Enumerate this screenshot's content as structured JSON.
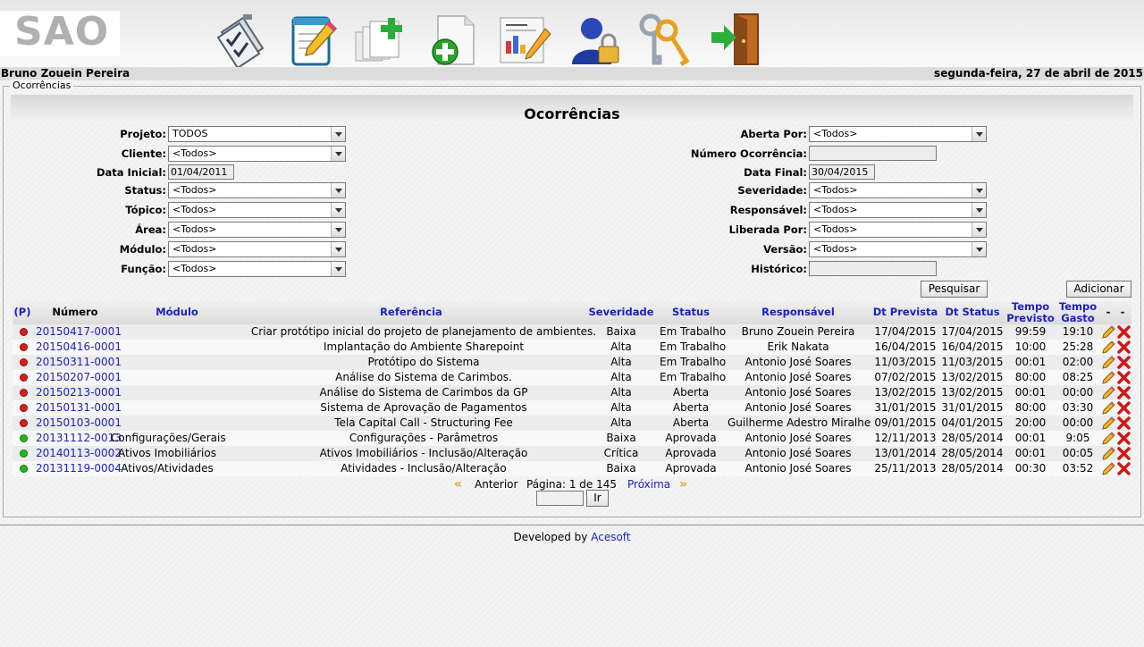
{
  "app": {
    "logo": "SAO"
  },
  "toolbar": {
    "icons": [
      "checklist-icon",
      "notepad-pencil-icon",
      "add-documents-icon",
      "new-document-icon",
      "report-icon",
      "user-lock-icon",
      "keys-icon",
      "exit-door-icon"
    ]
  },
  "userbar": {
    "user": "Bruno Zouein Pereira",
    "date": "segunda-feira, 27 de abril de 2015"
  },
  "section": {
    "legend": "Ocorrências",
    "title": "Ocorrências"
  },
  "filters": {
    "projeto_label": "Projeto:",
    "projeto_value": "TODOS",
    "cliente_label": "Cliente:",
    "cliente_value": "<Todos>",
    "data_inicial_label": "Data Inicial:",
    "data_inicial_value": "01/04/2011",
    "status_label": "Status:",
    "status_value": "<Todos>",
    "topico_label": "Tópico:",
    "topico_value": "<Todos>",
    "area_label": "Área:",
    "area_value": "<Todos>",
    "modulo_label": "Módulo:",
    "modulo_value": "<Todos>",
    "funcao_label": "Função:",
    "funcao_value": "<Todos>",
    "aberta_por_label": "Aberta Por:",
    "aberta_por_value": "<Todos>",
    "numero_label": "Número Ocorrência:",
    "numero_value": "",
    "data_final_label": "Data Final:",
    "data_final_value": "30/04/2015",
    "severidade_label": "Severidade:",
    "severidade_value": "<Todos>",
    "responsavel_label": "Responsável:",
    "responsavel_value": "<Todos>",
    "liberada_label": "Liberada Por:",
    "liberada_value": "<Todos>",
    "versao_label": "Versão:",
    "versao_value": "<Todos>",
    "historico_label": "Histórico:",
    "historico_value": ""
  },
  "buttons": {
    "pesquisar": "Pesquisar",
    "adicionar": "Adicionar",
    "ir": "Ir"
  },
  "columns": {
    "p": "(P)",
    "numero": "Número",
    "modulo": "Módulo",
    "referencia": "Referência",
    "severidade": "Severidade",
    "status": "Status",
    "responsavel": "Responsável",
    "dt_prevista": "Dt Prevista",
    "dt_status": "Dt Status",
    "tempo_previsto_1": "Tempo",
    "tempo_previsto_2": "Previsto",
    "tempo_gasto_1": "Tempo",
    "tempo_gasto_2": "Gasto",
    "dash1": "-",
    "dash2": "-"
  },
  "colors": {
    "red_dot": "#d81e1e",
    "green_dot": "#22b622",
    "link": "#1e20c0"
  },
  "rows": [
    {
      "dot": "red",
      "numero": "20150417-0001",
      "modulo": "",
      "referencia": "Criar protótipo inicial do projeto de planejamento de ambientes.",
      "severidade": "Baixa",
      "status": "Em Trabalho",
      "responsavel": "Bruno Zouein Pereira",
      "dt_prevista": "17/04/2015",
      "dt_status": "17/04/2015",
      "tempo_previsto": "99:59",
      "tempo_gasto": "19:10"
    },
    {
      "dot": "red",
      "numero": "20150416-0001",
      "modulo": "",
      "referencia": "Implantação do Ambiente Sharepoint",
      "severidade": "Alta",
      "status": "Em Trabalho",
      "responsavel": "Erik Nakata",
      "dt_prevista": "16/04/2015",
      "dt_status": "16/04/2015",
      "tempo_previsto": "10:00",
      "tempo_gasto": "25:28"
    },
    {
      "dot": "red",
      "numero": "20150311-0001",
      "modulo": "",
      "referencia": "Protótipo do Sistema",
      "severidade": "Alta",
      "status": "Em Trabalho",
      "responsavel": "Antonio José Soares",
      "dt_prevista": "11/03/2015",
      "dt_status": "11/03/2015",
      "tempo_previsto": "00:01",
      "tempo_gasto": "02:00"
    },
    {
      "dot": "red",
      "numero": "20150207-0001",
      "modulo": "",
      "referencia": "Análise do Sistema de Carimbos.",
      "severidade": "Alta",
      "status": "Em Trabalho",
      "responsavel": "Antonio José Soares",
      "dt_prevista": "07/02/2015",
      "dt_status": "13/02/2015",
      "tempo_previsto": "80:00",
      "tempo_gasto": "08:25"
    },
    {
      "dot": "red",
      "numero": "20150213-0001",
      "modulo": "",
      "referencia": "Análise do Sistema de Carimbos da GP",
      "severidade": "Alta",
      "status": "Aberta",
      "responsavel": "Antonio José Soares",
      "dt_prevista": "13/02/2015",
      "dt_status": "13/02/2015",
      "tempo_previsto": "00:01",
      "tempo_gasto": "00:00"
    },
    {
      "dot": "red",
      "numero": "20150131-0001",
      "modulo": "",
      "referencia": "Sistema de Aprovação de Pagamentos",
      "severidade": "Alta",
      "status": "Aberta",
      "responsavel": "Antonio José Soares",
      "dt_prevista": "31/01/2015",
      "dt_status": "31/01/2015",
      "tempo_previsto": "80:00",
      "tempo_gasto": "03:30"
    },
    {
      "dot": "red",
      "numero": "20150103-0001",
      "modulo": "",
      "referencia": "Tela Capital Call - Structuring Fee",
      "severidade": "Alta",
      "status": "Aberta",
      "responsavel": "Guilherme Adestro Miralhe",
      "dt_prevista": "09/01/2015",
      "dt_status": "04/01/2015",
      "tempo_previsto": "20:00",
      "tempo_gasto": "00:00"
    },
    {
      "dot": "green",
      "numero": "20131112-0013",
      "modulo": "Configurações/Gerais",
      "referencia": "Configurações - Parâmetros",
      "severidade": "Baixa",
      "status": "Aprovada",
      "responsavel": "Antonio José Soares",
      "dt_prevista": "12/11/2013",
      "dt_status": "28/05/2014",
      "tempo_previsto": "00:01",
      "tempo_gasto": "9:05"
    },
    {
      "dot": "green",
      "numero": "20140113-0002",
      "modulo": "Ativos Imobiliários",
      "referencia": "Ativos Imobiliários - Inclusão/Alteração",
      "severidade": "Crítica",
      "status": "Aprovada",
      "responsavel": "Antonio José Soares",
      "dt_prevista": "13/01/2014",
      "dt_status": "28/05/2014",
      "tempo_previsto": "00:01",
      "tempo_gasto": "00:05"
    },
    {
      "dot": "green",
      "numero": "20131119-0004",
      "modulo": "Ativos/Atividades",
      "referencia": "Atividades - Inclusão/Alteração",
      "severidade": "Baixa",
      "status": "Aprovada",
      "responsavel": "Antonio José Soares",
      "dt_prevista": "25/11/2013",
      "dt_status": "28/05/2014",
      "tempo_previsto": "00:30",
      "tempo_gasto": "03:52"
    }
  ],
  "pager": {
    "anterior": "Anterior",
    "pagina": "Página: 1 de 145",
    "proxima": "Próxima",
    "page_input": ""
  },
  "footer": {
    "text": "Developed by",
    "brand": "Acesoft"
  }
}
